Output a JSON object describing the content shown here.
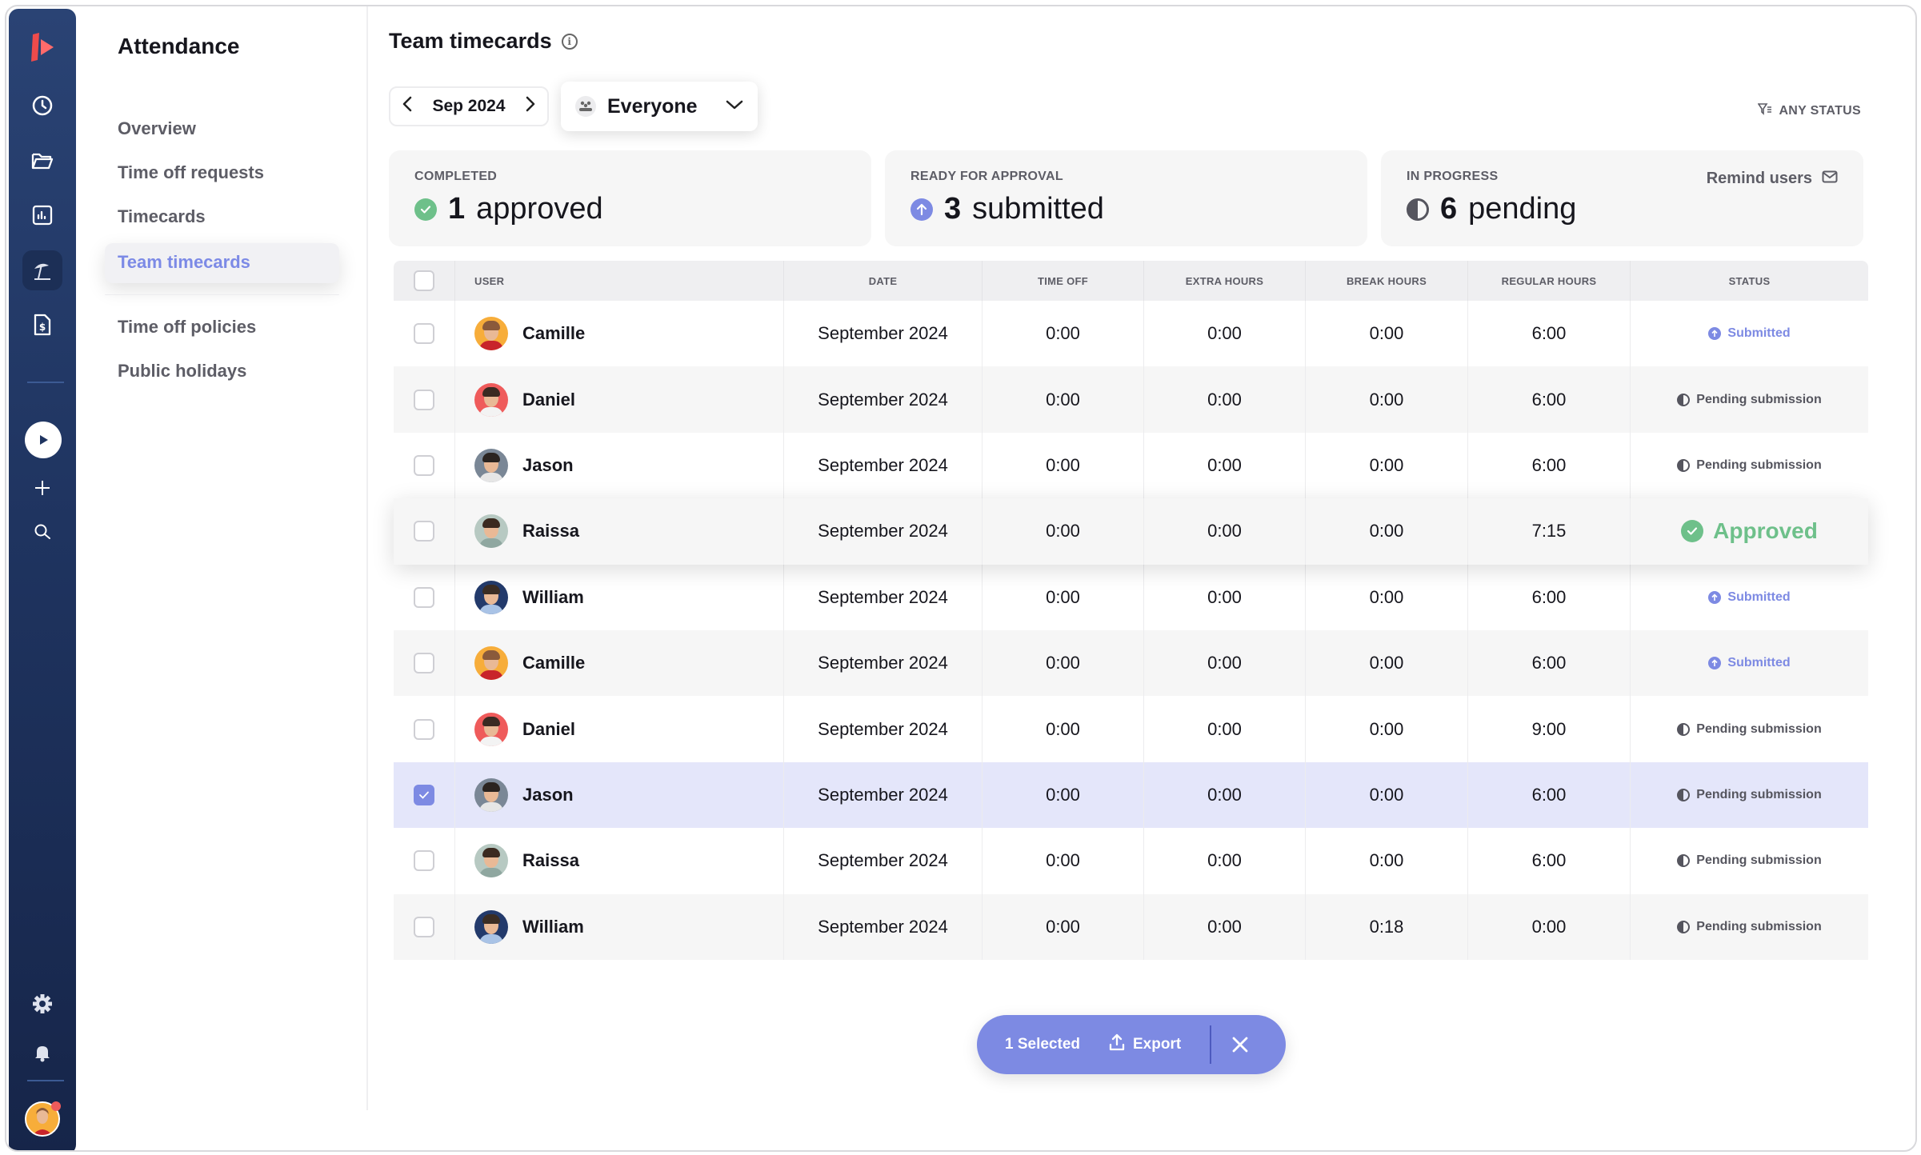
{
  "rail": {
    "icons": [
      "logo-icon",
      "clock-icon",
      "folder-icon",
      "reports-icon",
      "vacation-icon",
      "invoice-icon",
      "play-icon",
      "plus-icon",
      "search-icon",
      "gear-icon",
      "bell-icon"
    ]
  },
  "subnav": {
    "title": "Attendance",
    "items": [
      {
        "label": "Overview"
      },
      {
        "label": "Time off requests"
      },
      {
        "label": "Timecards"
      },
      {
        "label": "Team timecards",
        "active": true
      },
      {
        "label": "Time off policies"
      },
      {
        "label": "Public holidays"
      }
    ]
  },
  "header": {
    "title": "Team timecards",
    "info_icon": "i",
    "month": "Sep 2024",
    "group_filter": "Everyone",
    "status_filter": "ANY STATUS"
  },
  "summary": {
    "completed": {
      "caption": "COMPLETED",
      "count": "1",
      "label": "approved"
    },
    "ready": {
      "caption": "READY FOR APPROVAL",
      "count": "3",
      "label": "submitted"
    },
    "in_progress": {
      "caption": "IN PROGRESS",
      "count": "6",
      "label": "pending",
      "action": "Remind users"
    }
  },
  "table": {
    "columns": [
      "USER",
      "DATE",
      "TIME OFF",
      "EXTRA HOURS",
      "BREAK HOURS",
      "REGULAR HOURS",
      "STATUS"
    ],
    "rows": [
      {
        "user": "Camille",
        "date": "September 2024",
        "time_off": "0:00",
        "extra": "0:00",
        "break": "0:00",
        "regular": "6:00",
        "status": "Submitted",
        "status_type": "submitted",
        "checked": false
      },
      {
        "user": "Daniel",
        "date": "September 2024",
        "time_off": "0:00",
        "extra": "0:00",
        "break": "0:00",
        "regular": "6:00",
        "status": "Pending submission",
        "status_type": "pending",
        "checked": false
      },
      {
        "user": "Jason",
        "date": "September 2024",
        "time_off": "0:00",
        "extra": "0:00",
        "break": "0:00",
        "regular": "6:00",
        "status": "Pending submission",
        "status_type": "pending",
        "checked": false
      },
      {
        "user": "Raissa",
        "date": "September 2024",
        "time_off": "0:00",
        "extra": "0:00",
        "break": "0:00",
        "regular": "7:15",
        "status": "Approved",
        "status_type": "approved",
        "checked": false
      },
      {
        "user": "William",
        "date": "September 2024",
        "time_off": "0:00",
        "extra": "0:00",
        "break": "0:00",
        "regular": "6:00",
        "status": "Submitted",
        "status_type": "submitted",
        "checked": false
      },
      {
        "user": "Camille",
        "date": "September 2024",
        "time_off": "0:00",
        "extra": "0:00",
        "break": "0:00",
        "regular": "6:00",
        "status": "Submitted",
        "status_type": "submitted",
        "checked": false
      },
      {
        "user": "Daniel",
        "date": "September 2024",
        "time_off": "0:00",
        "extra": "0:00",
        "break": "0:00",
        "regular": "9:00",
        "status": "Pending submission",
        "status_type": "pending",
        "checked": false
      },
      {
        "user": "Jason",
        "date": "September 2024",
        "time_off": "0:00",
        "extra": "0:00",
        "break": "0:00",
        "regular": "6:00",
        "status": "Pending submission",
        "status_type": "pending",
        "checked": true
      },
      {
        "user": "Raissa",
        "date": "September 2024",
        "time_off": "0:00",
        "extra": "0:00",
        "break": "0:00",
        "regular": "6:00",
        "status": "Pending submission",
        "status_type": "pending",
        "checked": false
      },
      {
        "user": "William",
        "date": "September 2024",
        "time_off": "0:00",
        "extra": "0:00",
        "break": "0:18",
        "regular": "0:00",
        "status": "Pending submission",
        "status_type": "pending",
        "checked": false
      }
    ]
  },
  "action_bar": {
    "selected": "1 Selected",
    "export": "Export"
  },
  "colors": {
    "accent": "#7d8ae3",
    "approved": "#6ec08a",
    "rail": "#1f3460",
    "selected_row": "#e4e6fa"
  },
  "avatars": {
    "Camille": {
      "bg": "#f7ad3a",
      "hair": "#8a5a3b",
      "body": "#c8242b"
    },
    "Daniel": {
      "bg": "#ef5b5b",
      "hair": "#3a2a22",
      "body": "#f3f3f3"
    },
    "Jason": {
      "bg": "#7a8796",
      "hair": "#2b2420",
      "body": "#e6e6e6"
    },
    "Raissa": {
      "bg": "#b7c9c2",
      "hair": "#3b2a20",
      "body": "#8fa7a0"
    },
    "William": {
      "bg": "#233a6b",
      "hair": "#3b2d24",
      "body": "#a9c3e6"
    }
  }
}
